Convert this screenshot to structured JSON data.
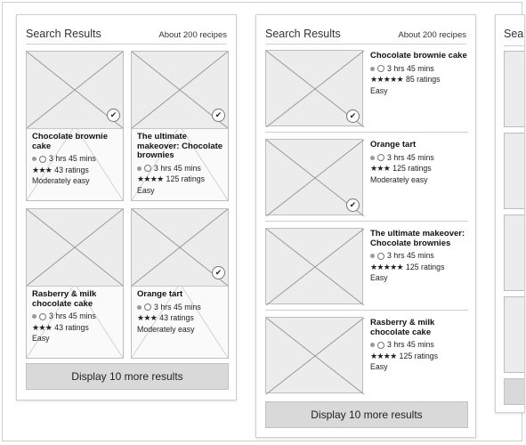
{
  "grid_view": {
    "header": {
      "title": "Search Results",
      "count": "About 200 recipes"
    },
    "recipes": [
      {
        "title": "Chocolate brownie cake",
        "time": "3 hrs 45 mins",
        "stars": "★★★",
        "ratings": "43 ratings",
        "difficulty": "Moderately easy",
        "saved": true
      },
      {
        "title": "The ultimate makeover: Chocolate brownies",
        "time": "3 hrs 45 mins",
        "stars": "★★★★",
        "ratings": "125 ratings",
        "difficulty": "Easy",
        "saved": true
      },
      {
        "title": "Rasberry & milk chocolate cake",
        "time": "3 hrs 45 mins",
        "stars": "★★★",
        "ratings": "43 ratings",
        "difficulty": "Easy",
        "saved": false
      },
      {
        "title": "Orange tart",
        "time": "3 hrs 45 mins",
        "stars": "★★★",
        "ratings": "43 ratings",
        "difficulty": "Moderately easy",
        "saved": true
      }
    ],
    "more_button": "Display 10 more results"
  },
  "list_view": {
    "header": {
      "title": "Search Results",
      "count": "About 200 recipes"
    },
    "recipes": [
      {
        "title": "Chocolate brownie cake",
        "time": "3 hrs 45 mins",
        "stars": "★★★★★",
        "ratings": "85 ratings",
        "difficulty": "Easy",
        "saved": true
      },
      {
        "title": "Orange tart",
        "time": "3 hrs 45 mins",
        "stars": "★★★",
        "ratings": "125 ratings",
        "difficulty": "Moderately easy",
        "saved": true
      },
      {
        "title": "The ultimate makeover: Chocolate brownies",
        "time": "3 hrs 45 mins",
        "stars": "★★★★★",
        "ratings": "125 ratings",
        "difficulty": "Easy",
        "saved": false
      },
      {
        "title": "Rasberry & milk chocolate cake",
        "time": "3 hrs 45 mins",
        "stars": "★★★★",
        "ratings": "125 ratings",
        "difficulty": "Easy",
        "saved": false
      }
    ],
    "more_button": "Display 10 more results"
  },
  "partial_view": {
    "header_title": "Sear"
  },
  "icons": {
    "save": "save-recipe-icon",
    "time": "clock-icon",
    "placeholder": "image-placeholder-icon"
  },
  "colors": {
    "panel_border": "#cfcfcf",
    "placeholder_fill": "#ececec",
    "button_fill": "#d9d9d9"
  }
}
